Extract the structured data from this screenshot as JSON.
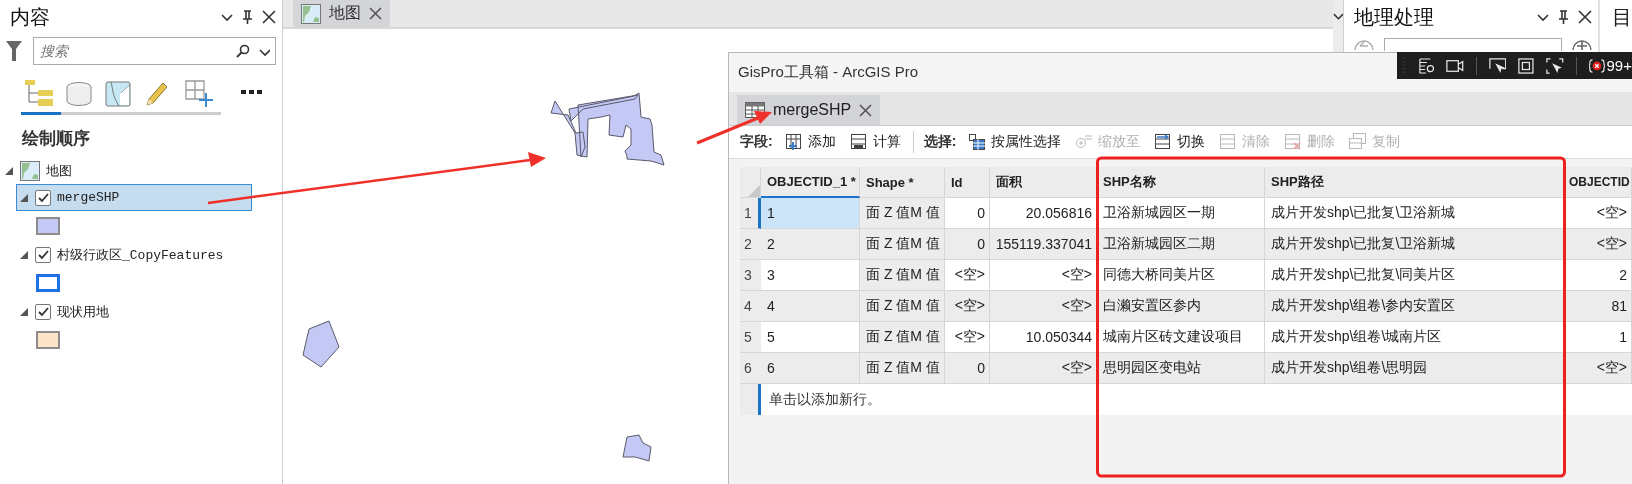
{
  "contents_pane": {
    "title": "内容",
    "search": {
      "placeholder": "搜索"
    },
    "tabs": [
      {
        "kind": "drawing_order",
        "selected": true
      },
      {
        "kind": "data_source",
        "selected": false
      },
      {
        "kind": "selection",
        "selected": false
      },
      {
        "kind": "editing",
        "selected": false
      },
      {
        "kind": "snapping",
        "selected": false
      }
    ],
    "heading": "绘制顺序",
    "tree": [
      {
        "label": "地图",
        "kind": "map",
        "expanded": true,
        "children": [
          {
            "label": "mergeSHP",
            "kind": "layer",
            "checked": true,
            "selected": true,
            "expanded": true,
            "symbol": {
              "kind": "fill",
              "color": "#c5c9f6"
            }
          },
          {
            "label": "村级行政区_CopyFeatures",
            "kind": "layer",
            "checked": true,
            "selected": false,
            "expanded": true,
            "symbol": {
              "kind": "outline",
              "color": "#1f6fe5"
            }
          },
          {
            "label": "现状用地",
            "kind": "layer",
            "checked": true,
            "selected": false,
            "expanded": true,
            "symbol": {
              "kind": "fill",
              "color": "#fde3c7"
            }
          }
        ]
      }
    ]
  },
  "map_view": {
    "tab": {
      "label": "地图",
      "selected": true
    }
  },
  "geoprocessing_pane": {
    "title": "地理处理"
  },
  "catalog_pane": {
    "title": "目"
  },
  "capture_toolbar": {
    "badge": "99+"
  },
  "table_window": {
    "title": "GisPro工具箱 - ArcGIS Pro",
    "tab": {
      "label": "mergeSHP",
      "selected": true
    },
    "toolbar": [
      {
        "kind": "label",
        "text": "字段:"
      },
      {
        "kind": "add",
        "label": "添加",
        "disabled": false
      },
      {
        "kind": "calculate",
        "label": "计算",
        "disabled": false
      },
      {
        "kind": "separator"
      },
      {
        "kind": "label",
        "text": "选择:"
      },
      {
        "kind": "select",
        "label": "按属性选择",
        "disabled": false
      },
      {
        "kind": "zoom",
        "label": "缩放至",
        "disabled": true
      },
      {
        "kind": "switch",
        "label": "切换",
        "disabled": false
      },
      {
        "kind": "clear",
        "label": "清除",
        "disabled": true
      },
      {
        "kind": "delete",
        "label": "删除",
        "disabled": true
      },
      {
        "kind": "copy",
        "label": "复制",
        "disabled": true
      }
    ],
    "columns": [
      {
        "label": "OBJECTID_1 *",
        "kind": "text"
      },
      {
        "label": "Shape *",
        "kind": "readonly"
      },
      {
        "label": "Id",
        "kind": "number"
      },
      {
        "label": "面积",
        "kind": "number"
      },
      {
        "label": "SHP名称",
        "kind": "text"
      },
      {
        "label": "SHP路径",
        "kind": "text"
      },
      {
        "label": "OBJECTID",
        "kind": "number"
      }
    ],
    "rows": [
      {
        "number": "1",
        "selected": true,
        "cells": [
          "1",
          "面 Z 值M 值",
          "0",
          "20.056816",
          "卫浴新城园区一期",
          "成片开发shp\\已批复\\卫浴新城",
          "<空>"
        ]
      },
      {
        "number": "2",
        "selected": false,
        "cells": [
          "2",
          "面 Z 值M 值",
          "0",
          "155119.337041",
          "卫浴新城园区二期",
          "成片开发shp\\已批复\\卫浴新城",
          "<空>"
        ]
      },
      {
        "number": "3",
        "selected": false,
        "cells": [
          "3",
          "面 Z 值M 值",
          "<空>",
          "<空>",
          "同德大桥同美片区",
          "成片开发shp\\已批复\\同美片区",
          "2"
        ]
      },
      {
        "number": "4",
        "selected": false,
        "cells": [
          "4",
          "面 Z 值M 值",
          "<空>",
          "<空>",
          "白濑安置区参内",
          "成片开发shp\\组卷\\参内安置区",
          "81"
        ]
      },
      {
        "number": "5",
        "selected": false,
        "cells": [
          "5",
          "面 Z 值M 值",
          "<空>",
          "10.050344",
          "城南片区砖文建设项目",
          "成片开发shp\\组卷\\城南片区",
          "1"
        ]
      },
      {
        "number": "6",
        "selected": false,
        "cells": [
          "6",
          "面 Z 值M 值",
          "0",
          "<空>",
          "思明园区变电站",
          "成片开发shp\\组卷\\思明园",
          "<空>"
        ]
      }
    ],
    "new_row_hint": "单击以添加新行。"
  }
}
